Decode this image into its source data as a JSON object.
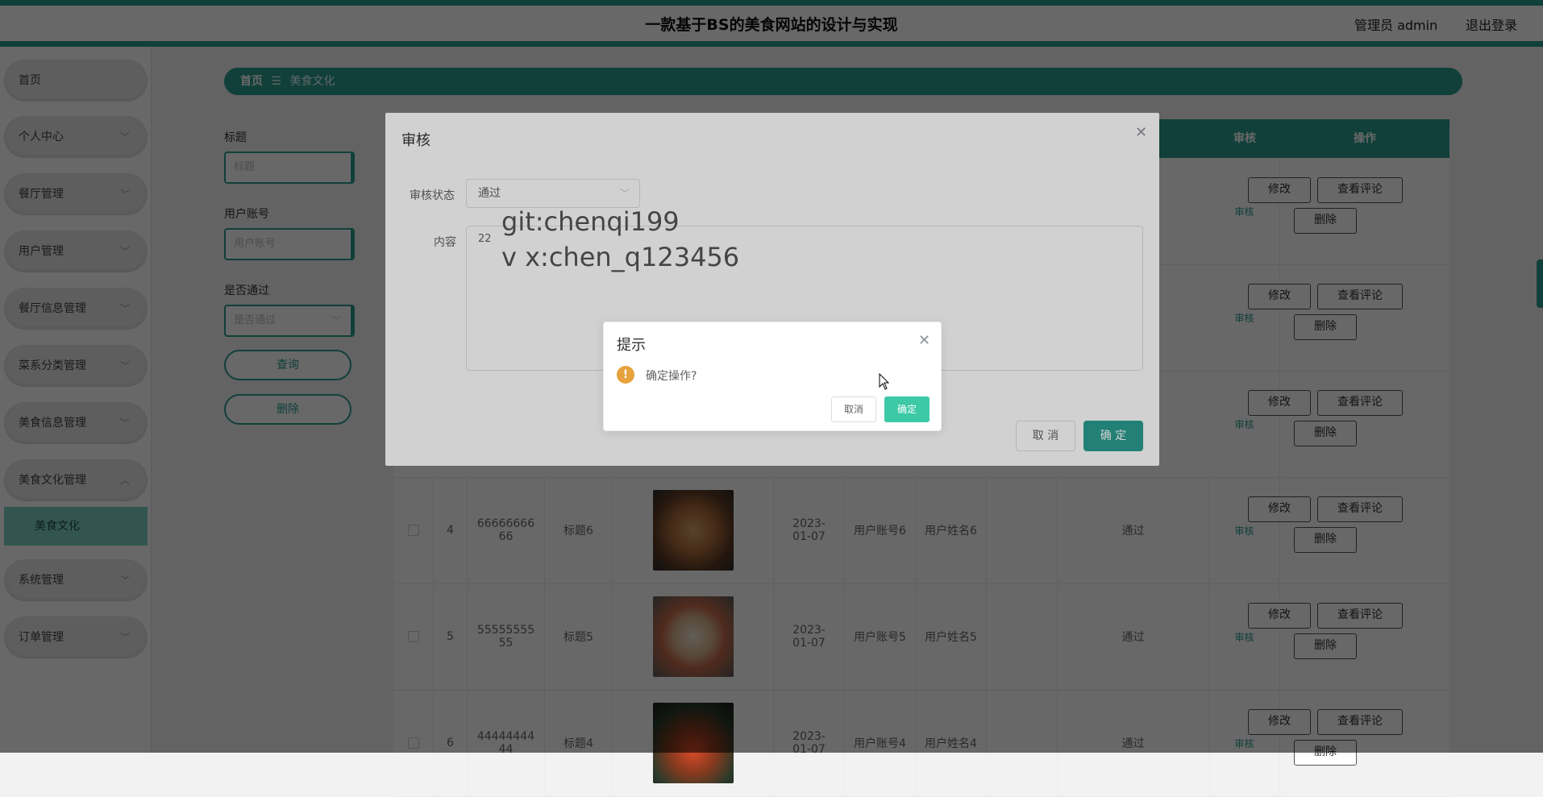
{
  "header": {
    "title": "一款基于BS的美食网站的设计与实现",
    "admin_label": "管理员 admin",
    "logout": "退出登录"
  },
  "sidebar": {
    "items": [
      {
        "label": "首页",
        "has_arrow": false
      },
      {
        "label": "个人中心",
        "has_arrow": true
      },
      {
        "label": "餐厅管理",
        "has_arrow": true
      },
      {
        "label": "用户管理",
        "has_arrow": true
      },
      {
        "label": "餐厅信息管理",
        "has_arrow": true
      },
      {
        "label": "菜系分类管理",
        "has_arrow": true
      },
      {
        "label": "美食信息管理",
        "has_arrow": true
      },
      {
        "label": "美食文化管理",
        "has_arrow": true
      },
      {
        "label": "系统管理",
        "has_arrow": true
      },
      {
        "label": "订单管理",
        "has_arrow": true
      }
    ],
    "active_sub": "美食文化"
  },
  "breadcrumb": {
    "home": "首页",
    "separator": "☰",
    "current": "美食文化"
  },
  "search": {
    "title_label": "标题",
    "title_placeholder": "标题",
    "account_label": "用户账号",
    "account_placeholder": "用户账号",
    "pass_label": "是否通过",
    "pass_placeholder": "是否通过",
    "query_button": "查询",
    "delete_button": "删除"
  },
  "table": {
    "headers": {
      "audit": "审核",
      "ops": "操作"
    },
    "rows": [
      {
        "no": "4",
        "id": "6666666666",
        "title": "标题6",
        "date": "2023-01-07",
        "account": "用户账号6",
        "name": "用户姓名6",
        "status": "通过",
        "img_color": "#8a5a3a"
      },
      {
        "no": "5",
        "id": "5555555555",
        "title": "标题5",
        "date": "2023-01-07",
        "account": "用户账号5",
        "name": "用户姓名5",
        "status": "通过",
        "img_color": "#b9a48a"
      },
      {
        "no": "6",
        "id": "4444444444",
        "title": "标题4",
        "date": "2023-01-07",
        "account": "用户账号4",
        "name": "用户姓名4",
        "status": "通过",
        "img_color": "#4a3a30"
      }
    ],
    "audit_link": "审核",
    "edit": "修改",
    "comments": "查看评论",
    "delete": "删除"
  },
  "audit_dialog": {
    "title": "审核",
    "status_label": "审核状态",
    "status_value": "通过",
    "content_label": "内容",
    "content_value": "22",
    "cancel": "取 消",
    "confirm": "确 定"
  },
  "watermark": {
    "line1": "git:chenqi199",
    "line2": "v x:chen_q123456"
  },
  "message_box": {
    "title": "提示",
    "text": "确定操作?",
    "cancel": "取消",
    "confirm": "确定",
    "icon": "!"
  }
}
